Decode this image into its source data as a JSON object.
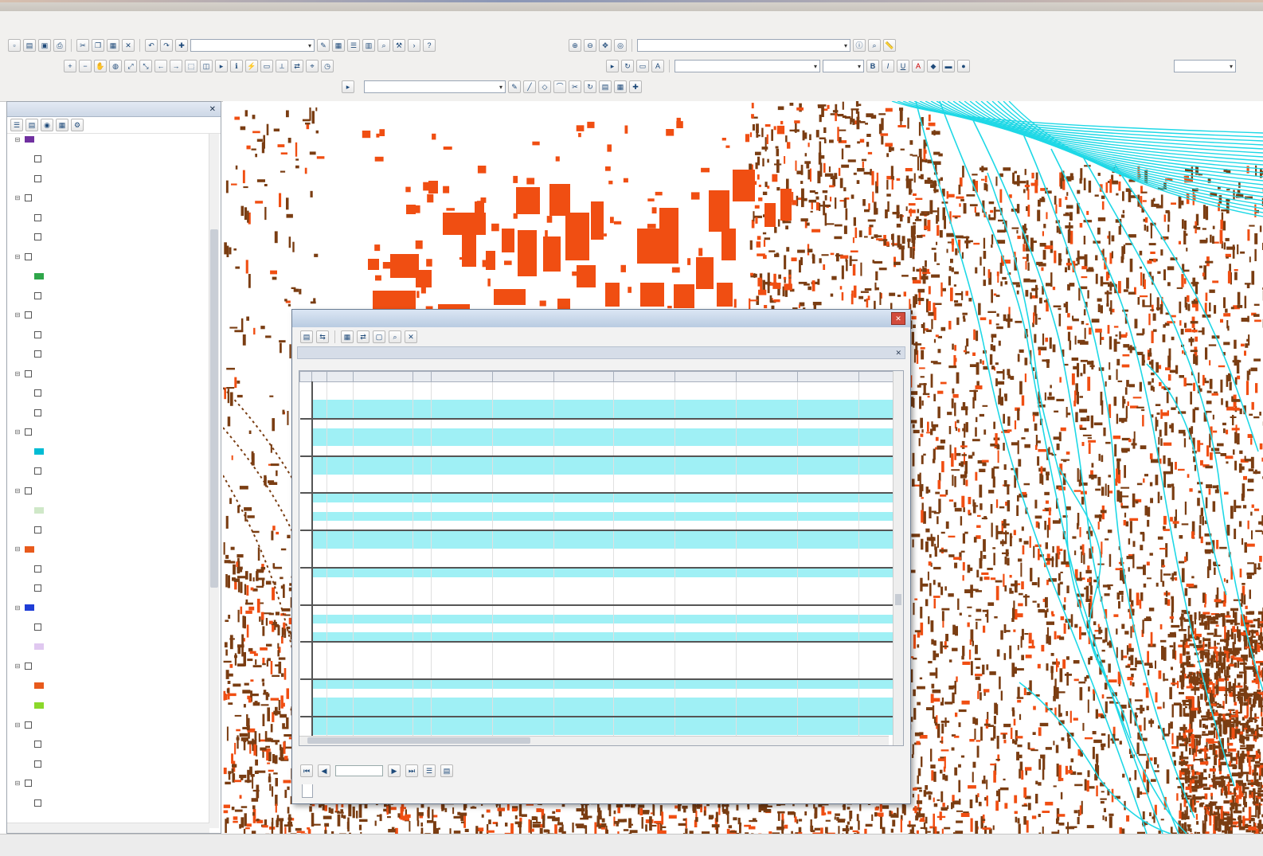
{
  "window": {
    "title": ""
  },
  "menu": [],
  "toolbars": {
    "editor_label": "",
    "layer_label": "",
    "layer_combo": "",
    "georef_label": "",
    "georef_combo": "",
    "labeling_label": "",
    "font_combo": "",
    "layer_combo_right": ""
  },
  "toc": {
    "title": "",
    "layers": [
      {
        "label": "",
        "swatch": "#7030a0"
      },
      {
        "label": ""
      },
      {
        "label": ""
      },
      {
        "label": ""
      },
      {
        "label": ""
      },
      {
        "label": ""
      },
      {
        "label": ""
      },
      {
        "label": "",
        "swatch": "#2fa64a"
      },
      {
        "label": ""
      },
      {
        "label": ""
      },
      {
        "label": ""
      },
      {
        "label": ""
      },
      {
        "label": ""
      },
      {
        "label": ""
      },
      {
        "label": ""
      },
      {
        "label": ""
      },
      {
        "label": "",
        "swatch": "#00bcd4"
      },
      {
        "label": ""
      },
      {
        "label": ""
      },
      {
        "label": "",
        "swatch": "#cfe8c8"
      },
      {
        "label": ""
      },
      {
        "label": "",
        "swatch": "#e85a1c"
      },
      {
        "label": ""
      },
      {
        "label": ""
      },
      {
        "label": "",
        "swatch": "#1f3dd6"
      },
      {
        "label": ""
      },
      {
        "label": "",
        "swatch": "#e0c8f0"
      },
      {
        "label": ""
      },
      {
        "label": "",
        "swatch": "#e85a1c"
      },
      {
        "label": "",
        "swatch": "#8bd82a"
      },
      {
        "label": ""
      },
      {
        "label": ""
      },
      {
        "label": ""
      },
      {
        "label": ""
      },
      {
        "label": ""
      }
    ]
  },
  "table_window": {
    "title": "",
    "tab_label": "",
    "selection_status": "",
    "bottom_tab": "",
    "columns": [
      "",
      "",
      "",
      "",
      "",
      "",
      "",
      "",
      "",
      "",
      "",
      ""
    ]
  },
  "colors": {
    "building_fill": "#f04e12",
    "contour_line": "#1fd8e6",
    "footprint_brown": "#7a3d12",
    "highlight_row": "#9ff0f5"
  }
}
